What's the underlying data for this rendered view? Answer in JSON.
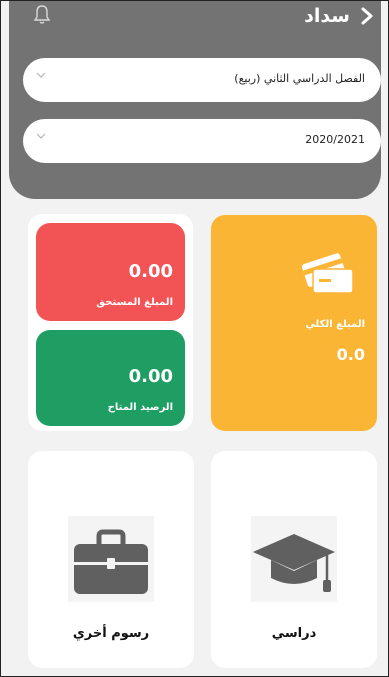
{
  "header": {
    "title": "سداد"
  },
  "filters": {
    "semester": "الفصل الدراسي الثاني (ربيع)",
    "year": "2020/2021"
  },
  "balances": {
    "due_amount": "0.00",
    "due_label": "المبلغ المستحق",
    "available_amount": "0.00",
    "available_label": "الرصيد المتاح",
    "total_label": "المبلغ الكلي",
    "total_amount": "0.0"
  },
  "nav": {
    "academic_label": "دراسي",
    "other_fees_label": "رسوم أخري"
  },
  "colors": {
    "top_panel": "#737373",
    "due": "#f25456",
    "available": "#1e9e63",
    "total": "#fbb535",
    "icon": "#606060"
  },
  "icons": [
    "bell-icon",
    "chevron-right-icon",
    "chevron-down-icon",
    "credit-cards-icon",
    "graduation-cap-icon",
    "briefcase-icon"
  ]
}
